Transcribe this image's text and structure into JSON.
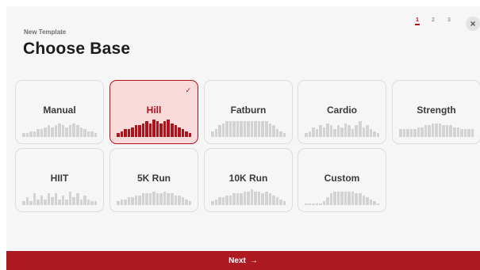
{
  "header": {
    "subtitle": "New Template",
    "title": "Choose Base"
  },
  "steps": [
    {
      "label": "1",
      "active": true
    },
    {
      "label": "2",
      "active": false
    },
    {
      "label": "3",
      "active": false
    }
  ],
  "close_icon": "×",
  "selected_icon": "✓",
  "cards": [
    {
      "label": "Manual",
      "selected": false,
      "profile": [
        2,
        2,
        3,
        3,
        4,
        4,
        5,
        6,
        5,
        6,
        7,
        6,
        5,
        6,
        7,
        6,
        5,
        4,
        3,
        3,
        2
      ]
    },
    {
      "label": "Hill",
      "selected": true,
      "profile": [
        2,
        3,
        4,
        4,
        5,
        6,
        6,
        7,
        8,
        7,
        9,
        8,
        7,
        8,
        9,
        7,
        6,
        5,
        4,
        3,
        2
      ]
    },
    {
      "label": "Fatburn",
      "selected": false,
      "profile": [
        3,
        4,
        6,
        7,
        8,
        8,
        8,
        8,
        8,
        8,
        8,
        8,
        8,
        8,
        8,
        8,
        7,
        6,
        4,
        3,
        2
      ]
    },
    {
      "label": "Cardio",
      "selected": false,
      "profile": [
        2,
        3,
        5,
        4,
        6,
        5,
        7,
        6,
        4,
        6,
        5,
        7,
        6,
        4,
        6,
        8,
        5,
        6,
        4,
        3,
        2
      ]
    },
    {
      "label": "Strength",
      "selected": false,
      "profile": [
        4,
        4,
        4,
        4,
        4,
        5,
        5,
        6,
        6,
        7,
        7,
        7,
        6,
        6,
        6,
        5,
        5,
        4,
        4,
        4,
        4
      ]
    },
    {
      "label": "HIIT",
      "selected": false,
      "profile": [
        2,
        4,
        2,
        6,
        3,
        5,
        3,
        6,
        4,
        6,
        3,
        5,
        3,
        7,
        4,
        6,
        3,
        5,
        3,
        2,
        2
      ]
    },
    {
      "label": "5K Run",
      "selected": false,
      "profile": [
        2,
        3,
        3,
        4,
        4,
        5,
        5,
        6,
        6,
        6,
        7,
        6,
        6,
        7,
        6,
        6,
        5,
        5,
        4,
        3,
        2
      ]
    },
    {
      "label": "10K Run",
      "selected": false,
      "profile": [
        2,
        3,
        4,
        4,
        5,
        5,
        6,
        6,
        6,
        7,
        7,
        8,
        7,
        7,
        6,
        7,
        6,
        5,
        4,
        3,
        2
      ]
    },
    {
      "label": "Custom",
      "selected": false,
      "profile": [
        1,
        1,
        1,
        1,
        1,
        2,
        4,
        6,
        7,
        7,
        7,
        7,
        7,
        7,
        6,
        6,
        5,
        4,
        3,
        2,
        1
      ]
    }
  ],
  "footer": {
    "next_label": "Next",
    "next_icon": "→"
  },
  "colors": {
    "accent": "#b0121b",
    "selected_background": "#f9dada",
    "bar_inactive": "#d3d3d3"
  }
}
